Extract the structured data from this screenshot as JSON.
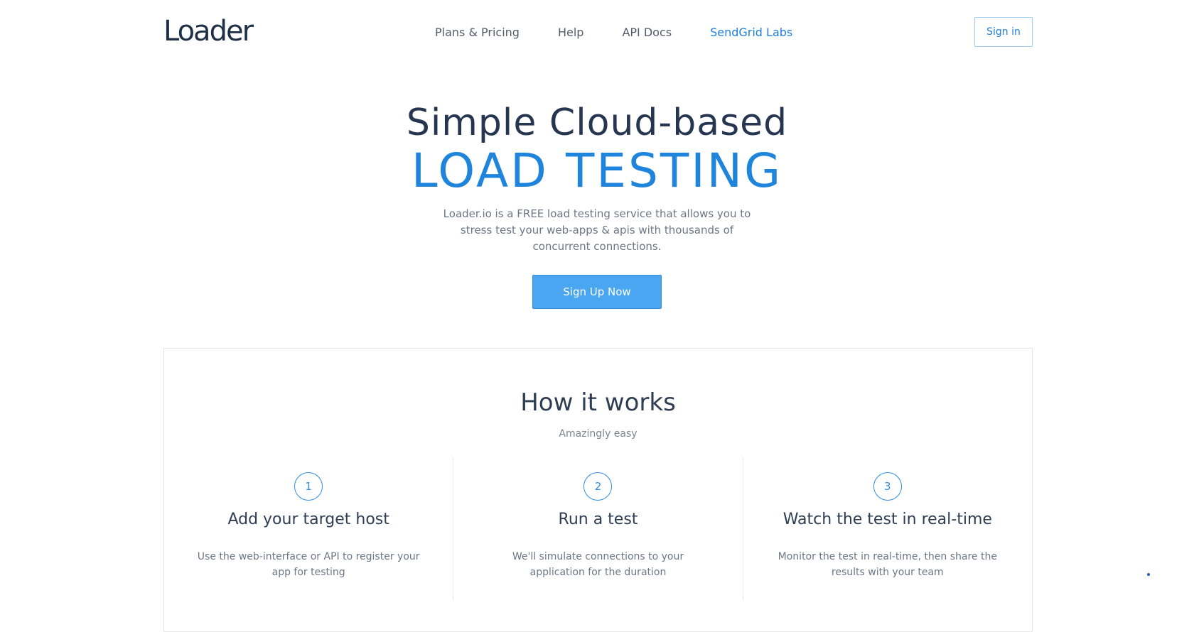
{
  "header": {
    "logo": "Loader",
    "nav": [
      "Plans & Pricing",
      "Help",
      "API Docs",
      "SendGrid Labs"
    ],
    "signin_label": "Sign in"
  },
  "hero": {
    "title_line1": "Simple Cloud-based",
    "title_line2": "LOAD TESTING",
    "description": "Loader.io is a FREE load testing service that allows you to stress test your web-apps & apis with thousands of concurrent connections.",
    "cta_label": "Sign Up Now"
  },
  "how": {
    "title": "How it works",
    "subtitle": "Amazingly easy",
    "steps": [
      {
        "number": "1",
        "title": "Add your target host",
        "text": "Use the web-interface or API to register your app for testing"
      },
      {
        "number": "2",
        "title": "Run a test",
        "text": "We'll simulate connections to your application for the duration"
      },
      {
        "number": "3",
        "title": "Watch the test in real-time",
        "text": "Monitor the test in real-time, then share the results with your team"
      }
    ]
  },
  "colors": {
    "accent": "#1f84dc",
    "button": "#4aa6f0",
    "heading": "#263650",
    "body_text": "#6c7786"
  }
}
